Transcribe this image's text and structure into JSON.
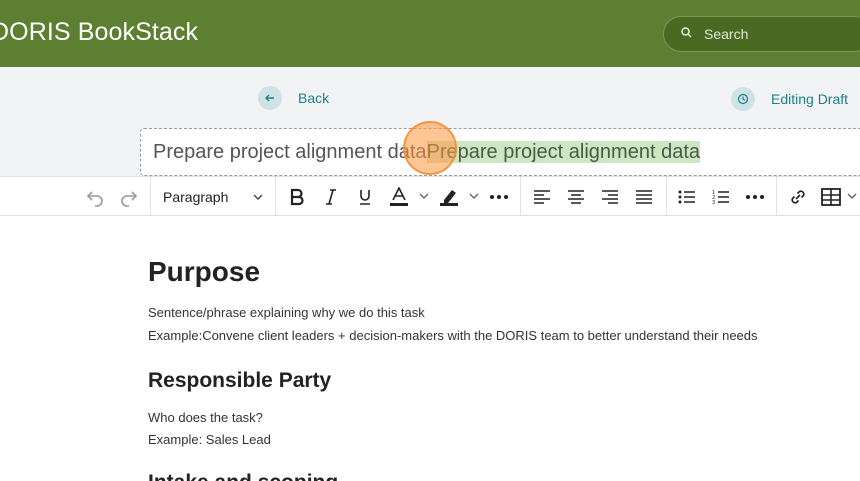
{
  "app": {
    "title": "DORIS BookStack"
  },
  "search": {
    "placeholder": "Search"
  },
  "edit_bar": {
    "back_label": "Back",
    "draft_label": "Editing Draft"
  },
  "title_field": {
    "typed_text": "Prepare project alignment data",
    "selected_text": "Prepare project alignment data"
  },
  "toolbar": {
    "format_value": "Paragraph",
    "items": [
      "undo",
      "redo",
      "format",
      "bold",
      "italic",
      "underline",
      "text-color",
      "highlight-color",
      "more",
      "align-left",
      "align-center",
      "align-right",
      "align-justify",
      "bullet-list",
      "numbered-list",
      "more",
      "link",
      "table"
    ]
  },
  "content": {
    "heading_purpose": "Purpose",
    "purpose_line1": "Sentence/phrase explaining why we do this task",
    "purpose_line2": "Example:Convene client leaders + decision-makers with the DORIS team to better understand their needs",
    "heading_responsible": "Responsible Party",
    "responsible_line1": "Who does the task?",
    "responsible_line2": "Example: Sales Lead",
    "heading_partial": "Intake and scoping"
  },
  "colors": {
    "header": "#5c7f32",
    "accent": "#1d7f8c",
    "selection": "#cfe6c4",
    "click_marker": "#ff963c"
  }
}
